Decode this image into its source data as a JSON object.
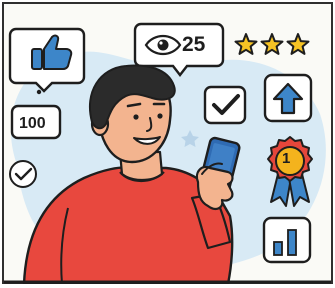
{
  "colors": {
    "ink": "#1e1e1e",
    "background_blob": "#d8eaf5",
    "shirt": "#e8483e",
    "skin": "#f3b48f",
    "hair": "#2b2b2b",
    "phone": "#2f6bb3",
    "icon_blue": "#3d86c9",
    "star": "#f6c324",
    "medal_ribbon": "#e5463b",
    "medal_face": "#f4b31d"
  },
  "icons": {
    "like": "thumbs-up-icon",
    "views": "eye-icon",
    "check": "checkmark-icon",
    "upload": "arrow-up-icon",
    "badge": "award-medal-icon",
    "growth": "bar-chart-icon"
  },
  "stats": {
    "views": "25",
    "likes": "100",
    "badge_rank": "1",
    "star_rating": 3,
    "star_rating_max": 3
  }
}
